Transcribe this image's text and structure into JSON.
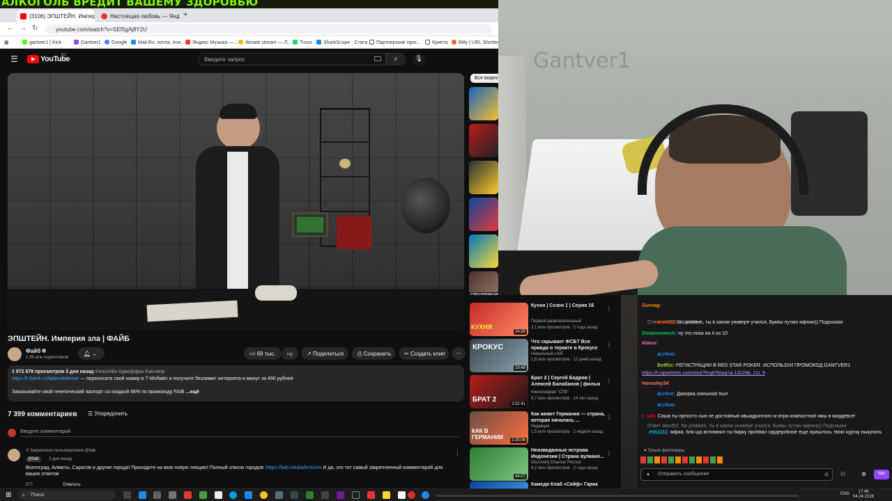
{
  "banner": "АЛКОГОЛЬ ВРЕДИТ ВАШЕМУ ЗДОРОВЬЮ",
  "browser": {
    "tabs": [
      {
        "label": "(3106) ЭПШТЕЙН. Империя",
        "color": "#ff0000"
      },
      {
        "label": "Настоящая любовь — Яндекс",
        "color": "#e53935"
      }
    ],
    "url": "youtube.com/watch?v=SEf5gAj8Y2U",
    "bookmarks": [
      "gantver1 | Kick",
      "Gantver1",
      "Google",
      "Mail.Ru: почта, пои...",
      "Яндекс Музыка —...",
      "donate.stream — Л...",
      "Trovo",
      "SharkScope · Стати...",
      "Партнерские прог...",
      "Крипта",
      "Bitly | URL Shortene..."
    ]
  },
  "youtube": {
    "logo": "YouTube",
    "logo_sup": "RU",
    "search_placeholder": "Введите запрос",
    "video_title": "ЭПШТЕЙН. Империя зла | ФАЙБ",
    "channel": "Файб",
    "subs": "2,35 млн подписчиков",
    "likes": "69 тыс.",
    "share": "Поделиться",
    "save": "Сохранить",
    "clip": "Создать клип",
    "desc_stats": "1 972 678 просмотров  3 дня назад",
    "desc_tags": "#эпштейн #джеффри #заговор",
    "desc_link": "https://t.tbank.ru/faibmobilemar",
    "desc_line1_rest": " — переносите свой номер в Т-Мобайл и получите безлимит интернета и минут за 490 рублей",
    "desc_line2": "Заказывайте свой генетический паспорт со скидкой 66% по промокоду FAIB ",
    "desc_more": "...ещё",
    "comments_count": "7 399 комментариев",
    "sort": "Упорядочить",
    "add_comment": "Введите комментарий",
    "pinned_by": "Закреплено пользователем @faib",
    "pinned_author": "@faib",
    "pinned_time": "3 дня назад",
    "pinned_text": "Волгоград, Алматы, Саратов и другие города! Приходите на мою новую лекцию! Полный список городов:",
    "pinned_link": "https://faib.media/lectures",
    "pinned_text2": " И да, это тот самый закрепленный комментарий для",
    "pinned_text3": "ваших ответов",
    "pinned_likes": "577",
    "reply": "Ответить",
    "all_videos": "Все видео",
    "sidebar_caption": "СПЕЦОПЕРАЦИЯ САДДАМА ХУСЕЙ"
  },
  "recommendations": [
    {
      "title": "Кухня | Сезон 1 | Серия 16",
      "channel": "Первый развлекательный",
      "meta": "2,1 млн просмотров · 2 года назад",
      "duration": "24:35",
      "color": "#c62828",
      "thumb_text": "КУХНЯ"
    },
    {
      "title": "Что скрывает ФСБ? Вся правда о теракте в Крокусе",
      "channel": "Навальный LIVE",
      "meta": "1,8 млн просмотров · 12 дней назад",
      "duration": "19:48",
      "color": "#37474f",
      "thumb_text": "КРОКУС"
    },
    {
      "title": "Брат 2 | Сергей Бодров | Алексей Балабанов | фильм",
      "channel": "Киноконцерн \"СТВ\"",
      "meta": "9,7 млн просмотров · 14 лет назад",
      "duration": "2:02:41",
      "color": "#b71c1c",
      "thumb_text": "БРАТ 2"
    },
    {
      "title": "Как живет Германия — страна, которая началась ...",
      "channel": "Редакция",
      "meta": "1,5 млн просмотров · 2 недели назад",
      "duration": "2:25:06",
      "color": "#6d4c41",
      "thumb_text": "КАК В ГЕРМАНИИ"
    },
    {
      "title": "Неизведанные острова Индонезии | Страна вулкано...",
      "channel": "Discovery Channel Россия",
      "meta": "6,2 млн просмотров · 2 года назад",
      "duration": "44:07",
      "color": "#2e7d32",
      "thumb_text": ""
    },
    {
      "title": "Камеди Клаб «Сейф» Гарик",
      "channel": "",
      "meta": "9,2 млн просмотров",
      "duration": "",
      "color": "#0d47a1",
      "thumb_text": ""
    }
  ],
  "chat": {
    "messages": [
      {
        "user": "Sunvag:",
        "text": "",
        "color": "#ff8c00"
      },
      {
        "user": "",
        "text": "Ответ eVo1111: синеньк",
        "color": "#888"
      },
      {
        "user": "atout52:",
        "text": " No problem, ты в каком универе учился, Буквы путаю мфнии)) Подсказки",
        "color": "#ff4500"
      },
      {
        "user": "Dimannemech:",
        "text": " ну это пока на 4 из 10",
        "color": "#00c853"
      },
      {
        "user": "Alaiss:",
        "text": "",
        "color": "#ff69b4"
      },
      {
        "user": "aLrAvo:",
        "text": "",
        "color": "#1e90ff"
      },
      {
        "user": "BotRix:",
        "text": " РЕГИСТРАЦИИ В RED STAR POKER. ИСПОЛЬЗУЙ ПРОМОКОД GANTVER1",
        "color": "#9acd32"
      },
      {
        "user": "",
        "text": "https://t.rspartners.com/click?hrgh?btag=a.13129b_21l_9",
        "color": "#bf94ff"
      },
      {
        "user": "Horoshiy34:",
        "text": "",
        "color": "#ff7f50"
      },
      {
        "user": "aLrAvo:",
        "text": " Дакорка смешной был",
        "color": "#1e90ff"
      },
      {
        "user": "aLrAvo:",
        "text": "",
        "color": "#1e90ff"
      },
      {
        "user": "r_sell:",
        "text": " Саша ты прпосто сын не достойный квыадратного м втра компостной ямы в мордевсе!",
        "color": "#ff0000"
      },
      {
        "user": "",
        "text": "Ответ atout52: No problem, ты в каком универе учился, Буквы путаю мфнии)) Подсказки",
        "color": "#888"
      },
      {
        "user": "eVo1111:",
        "text": " мфии, бля ща вспомнил ты бирку пробвал гардеробное еще пришлось твою куртку выкупать",
        "color": "#00bfff"
      }
    ],
    "followers_only": "Только фолловеры",
    "input_placeholder": "Отправить сообщение",
    "send": "Чат"
  },
  "taskbar": {
    "search": "Поиск",
    "lang": "ENG",
    "time": "17:46",
    "date": "04.04.2026"
  }
}
